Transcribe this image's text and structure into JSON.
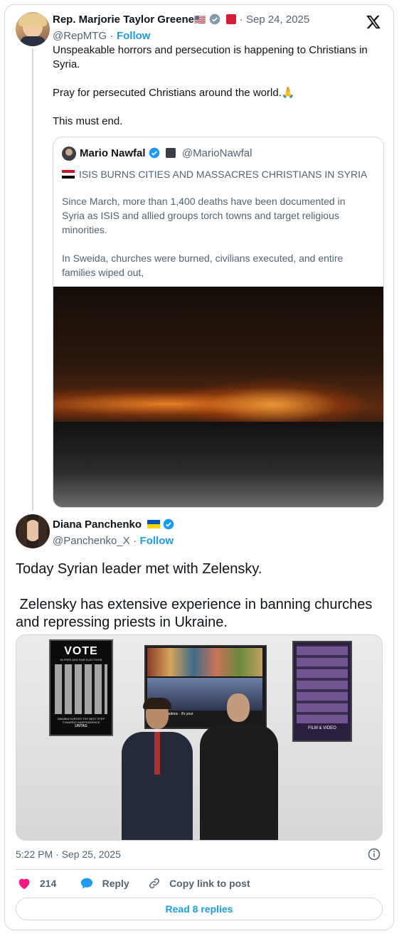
{
  "tweet": {
    "author_name": "Rep. Marjorie Taylor Greene",
    "author_handle": "@RepMTG",
    "follow_label": "Follow",
    "date": "Sep 24, 2025",
    "separator": "·",
    "lines": [
      "Unspeakable horrors and persecution is happening to Christians in",
      "Syria.",
      "Pray for persecuted Christians around the world.",
      "This must end."
    ],
    "emoji_pray": "🙏",
    "flag_emoji": "🇺🇸"
  },
  "quote": {
    "author_name": "Mario Nawfal",
    "author_handle": "@MarioNawfal",
    "headline": "ISIS BURNS CITIES AND MASSACRES CHRISTIANS IN SYRIA",
    "para1": [
      "Since March, more than 1,400 deaths have been documented in",
      "Syria as ISIS and allied groups torch towns and target religious",
      "minorities."
    ],
    "para2": [
      "In Sweida, churches were burned, civilians executed, and entire",
      "families wiped out,"
    ],
    "image_icon": "fire-landscape-photo"
  },
  "reply": {
    "author_name": "Diana Panchenko",
    "author_handle": "@Panchenko_X",
    "follow_label": "Follow",
    "separator": "·",
    "line1": "Today Syrian leader met with Zelensky.",
    "line2": " Zelensky has extensive experience in banning churches",
    "line3": "and repressing priests in Ukraine.",
    "timestamp": "5:22 PM · Sep 25, 2025",
    "poster_vote_title": "VOTE",
    "poster_vote_sub": "IN FREE AND FAIR ELECTIONS",
    "poster_vote_foot": "NAMIBIA SURGES THE NEXT STEP TOWARDS INDEPENDENCE",
    "poster_vote_org": "UNTAG",
    "poster_film": "FILM & VIDEO",
    "banner_text": "the United Nations · it's your"
  },
  "actions": {
    "like_count": "214",
    "reply_label": "Reply",
    "copy_label": "Copy link to post",
    "read_replies": "Read 8 replies"
  },
  "colors": {
    "accent": "#1d9bf0",
    "like": "#f91880",
    "muted": "#536471",
    "border": "#cfd9de"
  }
}
